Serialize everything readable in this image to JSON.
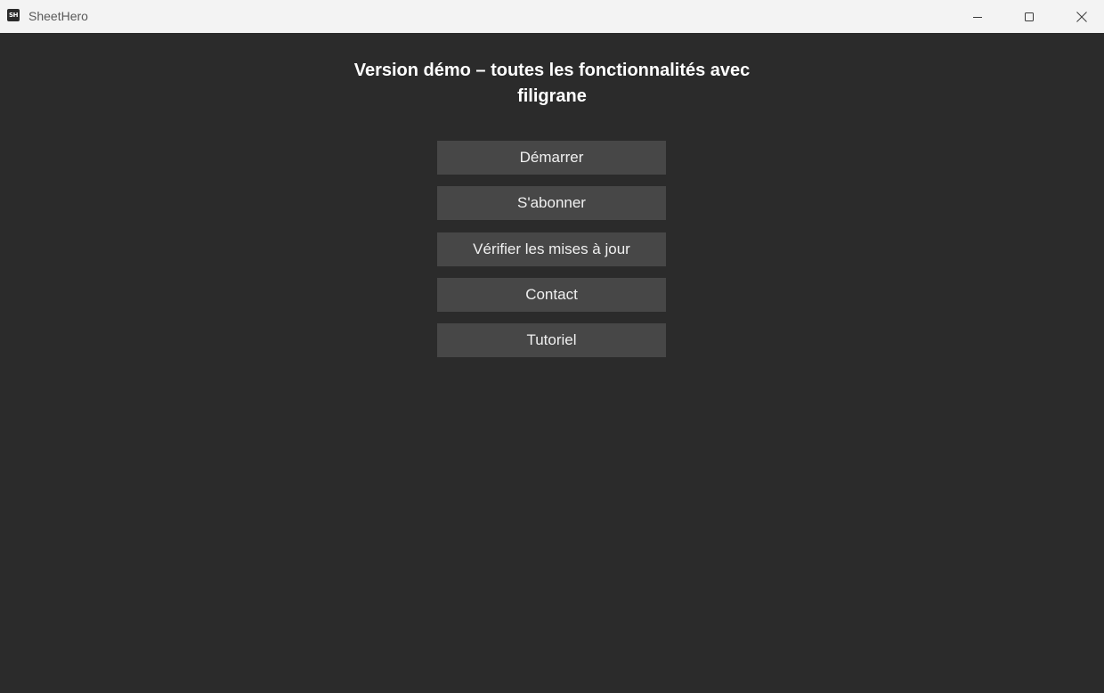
{
  "window": {
    "title": "SheetHero",
    "icon_text": "SH",
    "icon": "sheethero-app-icon",
    "controls": {
      "minimize_icon": "minimize-icon",
      "maximize_icon": "maximize-icon",
      "close_icon": "close-icon"
    }
  },
  "main": {
    "heading": "Version démo – toutes les fonctionnalités avec filigrane",
    "buttons": [
      {
        "label": "Démarrer"
      },
      {
        "label": "S'abonner"
      },
      {
        "label": "Vérifier les mises à jour"
      },
      {
        "label": "Contact"
      },
      {
        "label": "Tutoriel"
      }
    ]
  },
  "colors": {
    "background": "#2b2b2b",
    "titlebar": "#f3f3f3",
    "button": "#474747",
    "text": "#ffffff"
  }
}
